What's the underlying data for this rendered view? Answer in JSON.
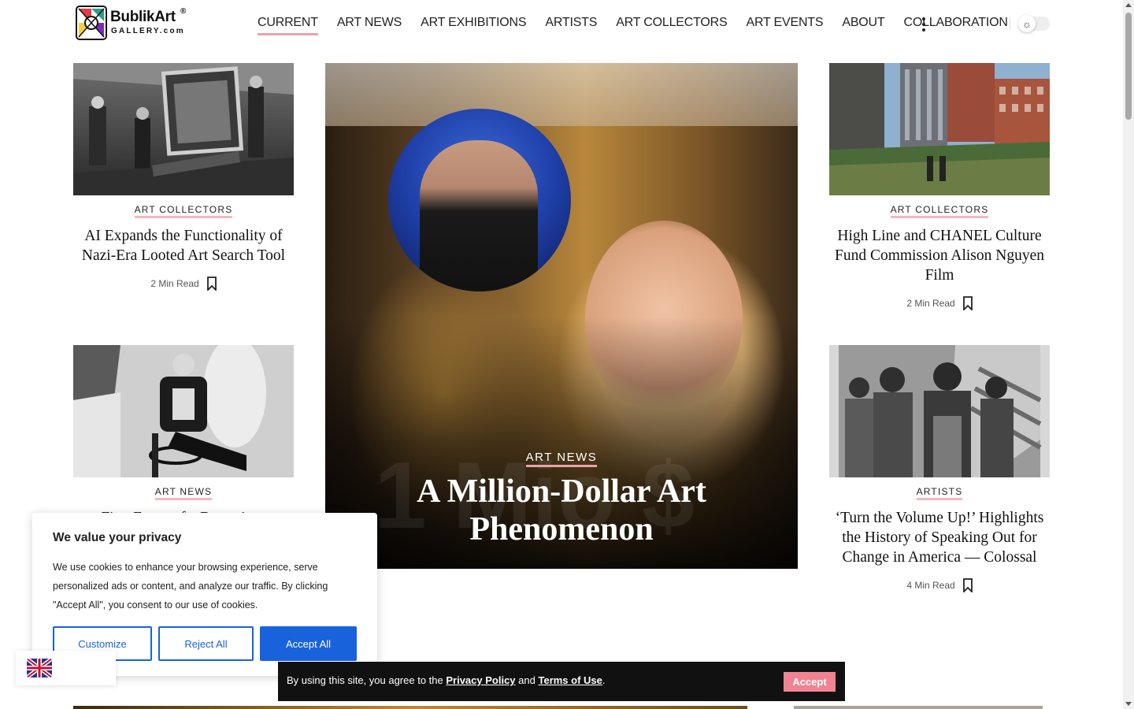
{
  "brand": {
    "name": "BublikArt",
    "reg": "®",
    "sub": "GALLERY.com"
  },
  "nav": [
    {
      "label": "CURRENT",
      "active": true
    },
    {
      "label": "ART NEWS",
      "active": false
    },
    {
      "label": "ART EXHIBITIONS",
      "active": false
    },
    {
      "label": "ARTISTS",
      "active": false
    },
    {
      "label": "ART COLLECTORS",
      "active": false
    },
    {
      "label": "ART EVENTS",
      "active": false
    },
    {
      "label": "ABOUT",
      "active": false
    },
    {
      "label": "COLLABORATION",
      "active": false
    }
  ],
  "header_icons": {
    "more": "more-vertical-icon",
    "theme": "sun-icon"
  },
  "cards": {
    "top_left": {
      "category": "ART COLLECTORS",
      "title": "AI Expands the Functionality of Nazi-Era Looted Art Search Tool",
      "read": "2 Min Read"
    },
    "top_right": {
      "category": "ART COLLECTORS",
      "title": "High Line and CHANEL Culture Fund Commission Alison Nguyen Film",
      "read": "2 Min Read"
    },
    "bottom_left": {
      "category": "ART NEWS",
      "title": "First Exam of a Botero's ...",
      "read": ""
    },
    "bottom_right": {
      "category": "ARTISTS",
      "title": "‘Turn the Volume Up!’ Highlights the History of Speaking Out for Change in America — Colossal",
      "read": "4 Min Read"
    }
  },
  "hero": {
    "category": "ART NEWS",
    "title": "A Million-Dollar Art Phenomenon",
    "watermark": "1 Mio $"
  },
  "privacy": {
    "title": "We value your privacy",
    "text": "We use cookies to enhance your browsing experience, serve personalized ads or content, and analyze our traffic. By clicking \"Accept All\", you consent to our use of cookies.",
    "customize": "Customize",
    "reject": "Reject All",
    "accept": "Accept All"
  },
  "terms": {
    "prefix": "By using this site, you agree to the",
    "privacy_link": "Privacy Policy",
    "and": "and",
    "terms_link": "Terms of Use",
    "suffix": ".",
    "accept": "Accept"
  },
  "colors": {
    "accent": "#e8a3ad",
    "cookie_blue": "#1863dc",
    "terms_btn": "#f08392"
  }
}
